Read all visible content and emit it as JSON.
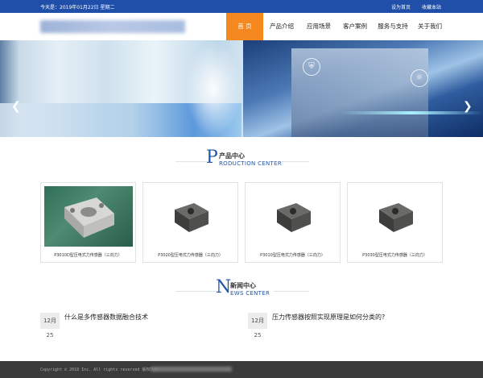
{
  "topbar": {
    "date": "今天是：2019年01月22日 星期二",
    "set_home": "设为首页",
    "bookmark": "收藏本站"
  },
  "header": {
    "nav": [
      {
        "label": "首  页",
        "active": true
      },
      {
        "label": "产品介绍",
        "active": false
      },
      {
        "label": "应用场景",
        "active": false
      },
      {
        "label": "客户案例",
        "active": false
      },
      {
        "label": "服务与支持",
        "active": false
      },
      {
        "label": "关于我们",
        "active": false
      }
    ]
  },
  "banner": {
    "prev_icon": "chevron-left-icon",
    "next_icon": "chevron-right-icon"
  },
  "products_section": {
    "big_letter": "P",
    "title_cn": "产品中心",
    "title_en": "RODUCTION CENTER",
    "items": [
      {
        "name": "P3010D型压电式力传感器（三向力）"
      },
      {
        "name": "P3020型压电式力传感器（三向力）"
      },
      {
        "name": "P3010型压电式力传感器（三向力）"
      },
      {
        "name": "P3030型压电式力传感器（三向力）"
      }
    ]
  },
  "news_section": {
    "big_letter": "N",
    "title_cn": "新闻中心",
    "title_en": "EWS CENTER",
    "items": [
      {
        "month": "12月",
        "day": "25",
        "title": "什么是多传感器数据融合技术"
      },
      {
        "month": "12月",
        "day": "25",
        "title": "压力传感器按照实现原理是如何分类的?"
      }
    ]
  },
  "footer": {
    "copyright": "Copyright © 2018 Inc. All rights reserved  版权所有:"
  }
}
